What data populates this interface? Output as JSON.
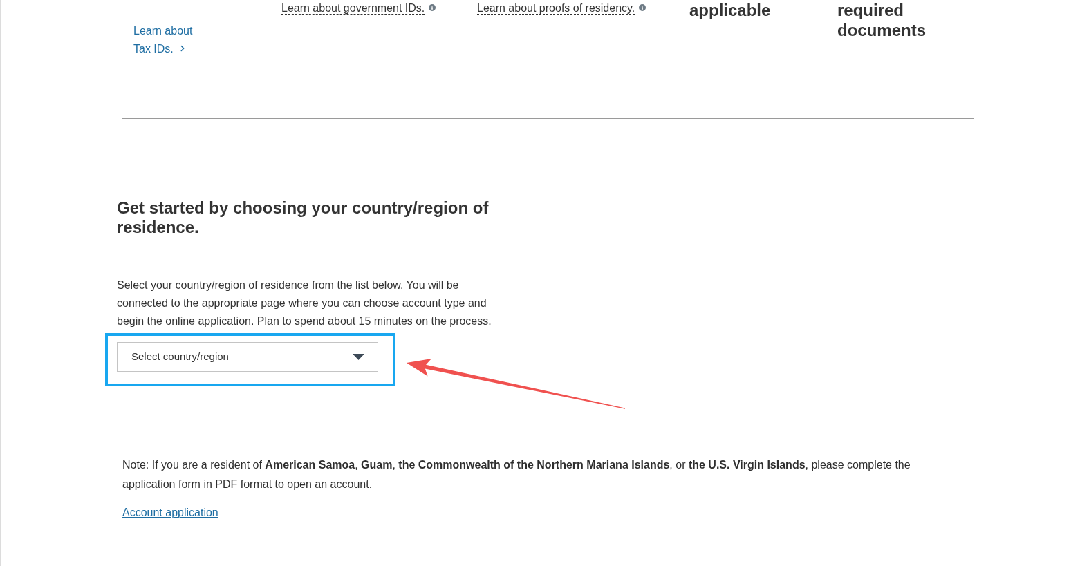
{
  "top_row": {
    "columns": [
      {
        "kind": "link",
        "text": "Learn about Tax IDs."
      },
      {
        "kind": "tip",
        "text": "Learn about government IDs."
      },
      {
        "kind": "tip",
        "text": "Learn about proofs of residency."
      },
      {
        "kind": "heading",
        "text": "applicable"
      },
      {
        "kind": "heading",
        "text": "required documents"
      }
    ]
  },
  "section": {
    "heading": "Get started by choosing your country/region of residence.",
    "description": "Select your country/region of residence from the list below. You will be connected to the appropriate page where you can choose account type and begin the online application. Plan to spend about 15 minutes on the process.",
    "country_select": {
      "placeholder": "Select country/region",
      "highlighted": true,
      "pointed_at": true
    }
  },
  "note": {
    "text": "Note: If you are a resident of **American Samoa**, **Guam**, **the Commonwealth of the Northern Mariana Islands**, or **the U.S. Virgin Islands**, please complete the application form in PDF format to open an account.",
    "link": "Account application"
  }
}
